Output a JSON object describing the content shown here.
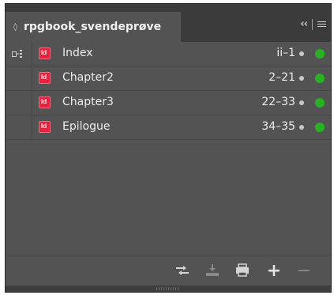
{
  "panel": {
    "tab_arrows": "◊",
    "title": "rpgbook_svendeprøve",
    "collapse_glyph": "‹‹",
    "menu_icon": "hamburger-menu-icon"
  },
  "documents": [
    {
      "name": "Index",
      "pages": "ii–1",
      "is_style_source": true,
      "status": "ok"
    },
    {
      "name": "Chapter2",
      "pages": "2–21",
      "is_style_source": false,
      "status": "ok"
    },
    {
      "name": "Chapter3",
      "pages": "22–33",
      "is_style_source": false,
      "status": "ok"
    },
    {
      "name": "Epilogue",
      "pages": "34–35",
      "is_style_source": false,
      "status": "ok"
    }
  ],
  "toolbar": {
    "buttons": [
      "synchronize-icon",
      "save-book-icon",
      "print-book-icon",
      "add-document-icon",
      "remove-document-icon"
    ],
    "add_glyph": "+",
    "remove_glyph": "−"
  },
  "colors": {
    "panel_bg": "#535353",
    "indesign_icon": "#e8213d",
    "status_green": "#27b321"
  }
}
